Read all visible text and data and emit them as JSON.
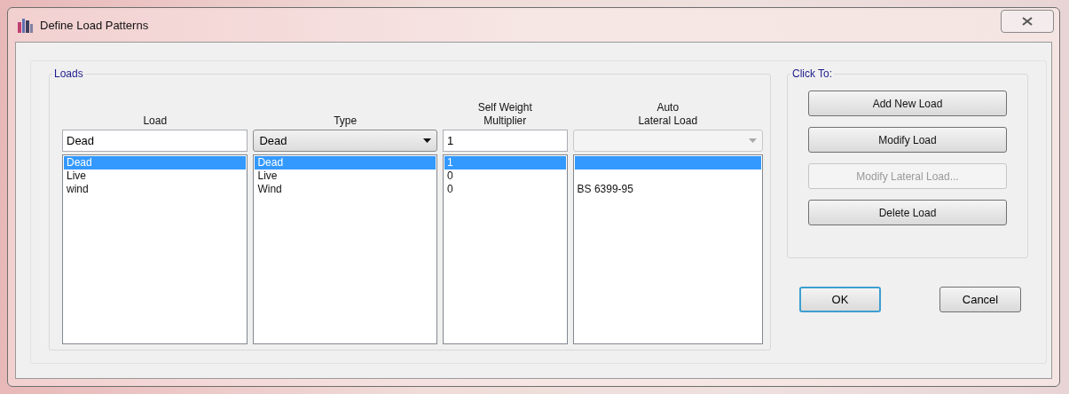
{
  "window": {
    "title": "Define Load Patterns"
  },
  "loads": {
    "label": "Loads",
    "headers": [
      [
        "Load"
      ],
      [
        "Type"
      ],
      [
        "Self Weight",
        "Multiplier"
      ],
      [
        "Auto",
        "Lateral Load"
      ]
    ],
    "load_field": {
      "value": "Dead"
    },
    "type_dropdown": {
      "value": "Dead"
    },
    "multiplier_field": {
      "value": "1"
    },
    "lateral_dropdown": {
      "disabled": true
    },
    "rows": [
      {
        "load": "Dead",
        "type": "Dead",
        "multiplier": "1",
        "selected": true
      },
      {
        "load": "Live",
        "type": "Live",
        "multiplier": "0",
        "selected": false
      },
      {
        "load": "wind",
        "type": "Wind",
        "multiplier": "0",
        "lateral": "BS 6399-95",
        "selected": false
      }
    ]
  },
  "actions": {
    "label": "Click To:",
    "buttons": [
      {
        "label": "Add New Load",
        "disabled": false
      },
      {
        "label": "Modify Load",
        "disabled": false
      },
      {
        "label": "Modify Lateral Load...",
        "disabled": true
      },
      {
        "label": "Delete Load",
        "disabled": false
      }
    ]
  },
  "footer": [
    {
      "label": "OK",
      "default": true
    },
    {
      "label": "Cancel",
      "default": false
    }
  ]
}
